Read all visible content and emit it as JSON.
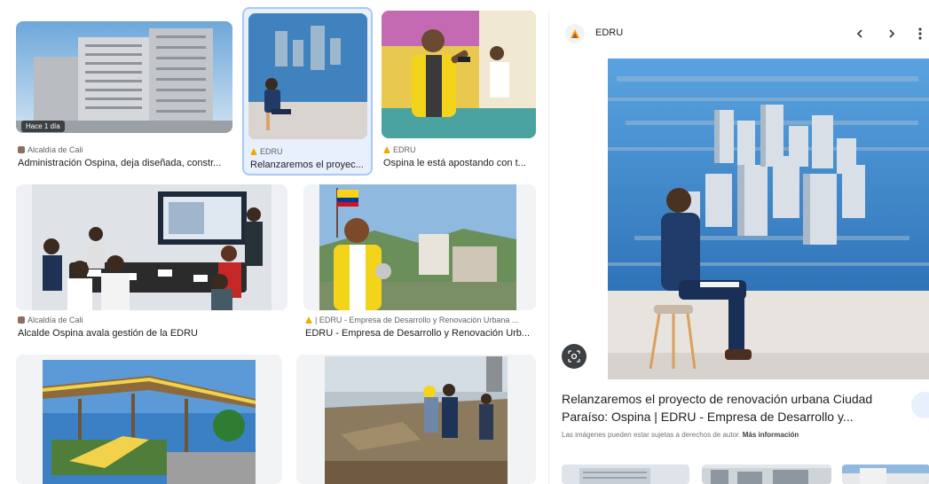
{
  "results": [
    {
      "source": "Alcaldía de Cali",
      "caption": "Administración Ospina, deja diseñada, constr...",
      "badge": "Hace 1 día",
      "icon": "alcaldia-favicon"
    },
    {
      "source": "EDRU",
      "caption": "Relanzaremos el proyec...",
      "icon": "edru-favicon"
    },
    {
      "source": "EDRU",
      "caption": "Ospina le está apostando con t...",
      "icon": "edru-favicon"
    },
    {
      "source": "Alcaldía de Cali",
      "caption": "Alcalde Ospina avala gestión de la EDRU",
      "icon": "alcaldia-favicon"
    },
    {
      "source": "| EDRU - Empresa de Desarrollo y Renovación Urbana ...",
      "caption": "EDRU - Empresa de Desarrollo y Renovación Urb...",
      "icon": "edru-favicon"
    }
  ],
  "panel": {
    "source_name": "EDRU",
    "title": "Relanzaremos el proyecto de renovación urbana Ciudad Paraíso: Ospina | EDRU - Empresa de Desarrollo y...",
    "disclaimer": "Las imágenes pueden estar sujetas a derechos de autor.",
    "more_info": "Más información",
    "prev_icon": "chevron-left-icon",
    "next_icon": "chevron-right-icon",
    "more_icon": "more-vert-icon",
    "lens_icon": "lens-icon"
  },
  "colors": {
    "selected_bg": "#e8f0fe",
    "selected_border": "#a8c7fa",
    "text": "#202124",
    "muted": "#5f6368"
  }
}
